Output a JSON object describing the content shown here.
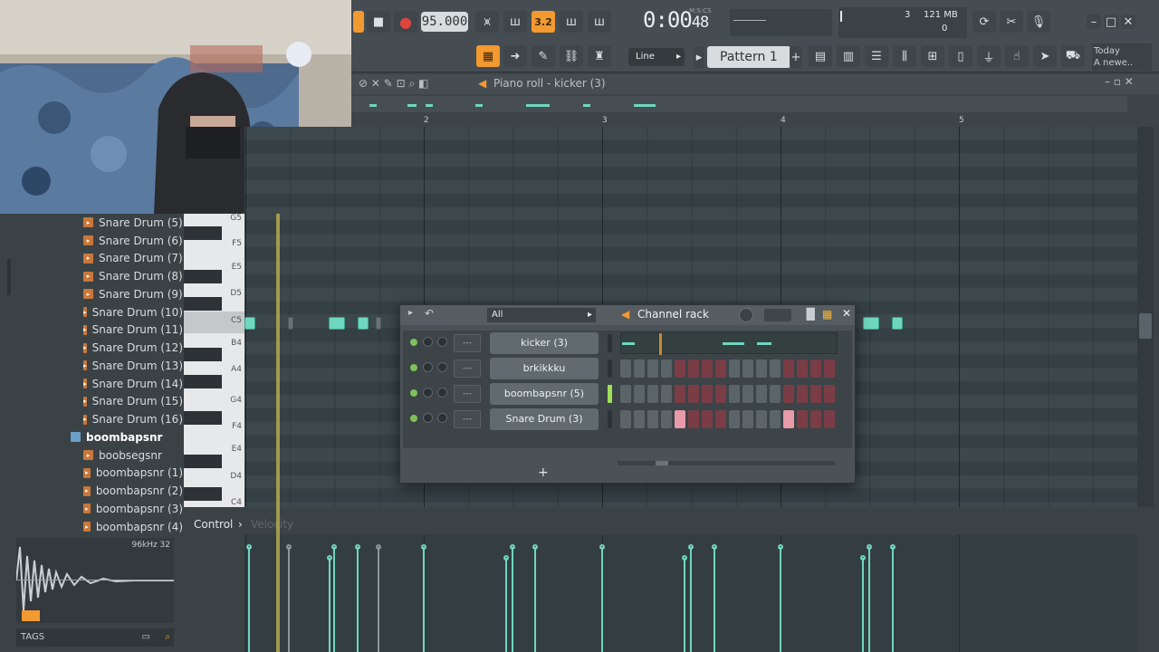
{
  "toolbar": {
    "tempo": "95.000",
    "song_time": "0:00",
    "song_time_frac": "48",
    "time_format": "M:S:CS",
    "snap_mode": "Line",
    "pattern": "Pattern 1",
    "cpu_value": "3",
    "memory": "121 MB",
    "poly": "0",
    "news_day": "Today",
    "news_text": "A newe..",
    "accent_color": "#f29a30"
  },
  "piano_roll": {
    "title": "Piano roll - kicker (3)",
    "bars": [
      "2",
      "3",
      "4",
      "5"
    ],
    "note_color": "#6fd6bf"
  },
  "keyboard": {
    "labels": [
      "G5",
      "F5",
      "E5",
      "D5",
      "C5",
      "B4",
      "A4",
      "G4",
      "F4",
      "E4",
      "D4",
      "C4"
    ]
  },
  "browser": {
    "items": [
      {
        "label": "Snare Drum (5)",
        "type": "file"
      },
      {
        "label": "Snare Drum (6)",
        "type": "file"
      },
      {
        "label": "Snare Drum (7)",
        "type": "file"
      },
      {
        "label": "Snare Drum (8)",
        "type": "file"
      },
      {
        "label": "Snare Drum (9)",
        "type": "file"
      },
      {
        "label": "Snare Drum (10)",
        "type": "file"
      },
      {
        "label": "Snare Drum (11)",
        "type": "file"
      },
      {
        "label": "Snare Drum (12)",
        "type": "file"
      },
      {
        "label": "Snare Drum (13)",
        "type": "file"
      },
      {
        "label": "Snare Drum (14)",
        "type": "file"
      },
      {
        "label": "Snare Drum (15)",
        "type": "file"
      },
      {
        "label": "Snare Drum (16)",
        "type": "file"
      },
      {
        "label": "boombapsnr",
        "type": "folder"
      },
      {
        "label": "boobsegsnr",
        "type": "file"
      },
      {
        "label": "boombapsnr (1)",
        "type": "file"
      },
      {
        "label": "boombapsnr (2)",
        "type": "file"
      },
      {
        "label": "boombapsnr (3)",
        "type": "file"
      },
      {
        "label": "boombapsnr (4)",
        "type": "file"
      }
    ],
    "sample_info": "96kHz 32",
    "tags_label": "TAGS"
  },
  "control": {
    "label": "Control",
    "param": "Velocity"
  },
  "channel_rack": {
    "title": "Channel rack",
    "filter": "All",
    "add_label": "+",
    "mixer_track_label": "---",
    "channels": [
      {
        "name": "kicker (3)",
        "selected": false,
        "mode": "piano"
      },
      {
        "name": "brkikkku",
        "selected": false,
        "mode": "steps",
        "steps": [
          0,
          0,
          0,
          0,
          0,
          0,
          0,
          0,
          0,
          0,
          0,
          0,
          0,
          0,
          0,
          0
        ]
      },
      {
        "name": "boombapsnr (5)",
        "selected": true,
        "mode": "steps",
        "steps": [
          0,
          0,
          0,
          0,
          0,
          0,
          0,
          0,
          0,
          0,
          0,
          0,
          0,
          0,
          0,
          0
        ]
      },
      {
        "name": "Snare Drum (3)",
        "selected": false,
        "mode": "steps",
        "steps": [
          0,
          0,
          0,
          0,
          1,
          0,
          0,
          0,
          0,
          0,
          0,
          0,
          1,
          0,
          0,
          0
        ]
      }
    ]
  }
}
